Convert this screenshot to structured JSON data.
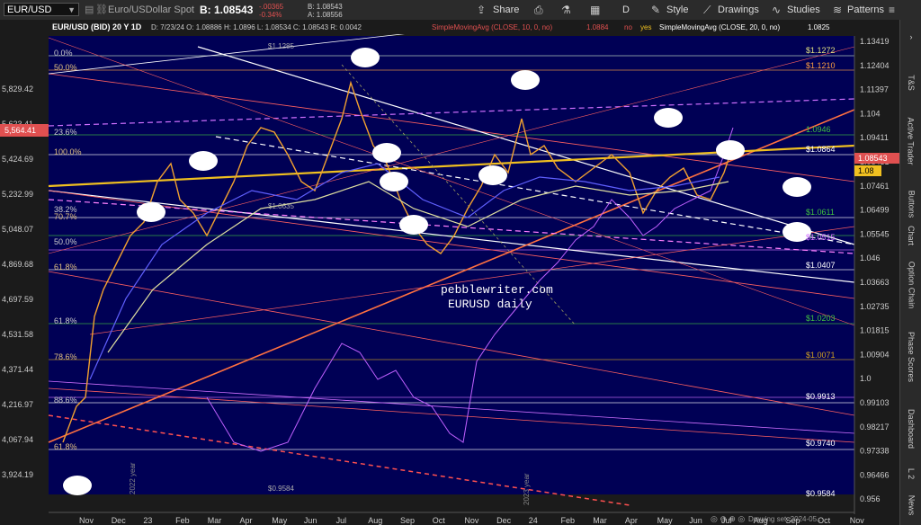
{
  "toolbar": {
    "symbol": "EUR/USD",
    "description": "Euro/USDollar Spot",
    "bid": "B: 1.08543",
    "change": "-.00365",
    "change_pct": "-0.34%",
    "bid_small": "B: 1.08543",
    "ask_small": "A: 1.08556",
    "share": "Share",
    "period": "D",
    "style": "Style",
    "drawings": "Drawings",
    "studies": "Studies",
    "patterns": "Patterns"
  },
  "header": {
    "title": "EUR/USD (BID) 20 Y 1D",
    "ohlc": "D: 7/23/24   O: 1.08886   H: 1.0896   L: 1.08534   C: 1.08543   R: 0.0042",
    "study1": "SimpleMovingAvg (CLOSE, 10, 0, no)",
    "study1_value": "1.0884",
    "no_label": "no",
    "yes_label": "yes",
    "study2": "SimpleMovingAvg (CLOSE, 20, 0, no)",
    "study2_value": "1.0825"
  },
  "watermark": {
    "line1": "pebblewriter.com",
    "line2": "EURUSD daily"
  },
  "left_axis": [
    "5,829.42",
    "5,623.41",
    "5,424.69",
    "5,232.99",
    "5,048.07",
    "4,869.68",
    "4,697.59",
    "4,531.58",
    "4,371.44",
    "4,216.97",
    "4,067.94",
    "3,924.19"
  ],
  "left_marker": "5,564.41",
  "right_axis": [
    "1.13419",
    "1.12404",
    "1.11397",
    "1.104",
    "1.09411",
    "1.08431",
    "1.07461",
    "1.06499",
    "1.05545",
    "1.046",
    "1.03663",
    "1.02735",
    "1.01815",
    "1.00904",
    "1.0",
    "0.99103",
    "0.98217",
    "0.97338",
    "0.96466",
    "0.956"
  ],
  "right_marker_price": "1.08543",
  "right_marker_level": "1.08",
  "x_labels": [
    "Nov",
    "Dec",
    "23",
    "Feb",
    "Mar",
    "Apr",
    "May",
    "Jun",
    "Jul",
    "Aug",
    "Sep",
    "Oct",
    "Nov",
    "Dec",
    "24",
    "Feb",
    "Mar",
    "Apr",
    "May",
    "Jun",
    "Jul",
    "Aug",
    "Sep",
    "Oct",
    "Nov"
  ],
  "fib_left": [
    "0.0%",
    "50.0%",
    "23.6%",
    "100.0%",
    "38.2%",
    "70.7%",
    "50.0%",
    "61.8%",
    "61.8%",
    "78.6%",
    "88.6%",
    "61.8%"
  ],
  "levels_right": [
    "$1.1272",
    "$1.1210",
    "1.0946",
    "$1.0864",
    "$1.0611",
    "$1.0515",
    "$1.0407",
    "$1.0203",
    "$1.0071",
    "$0.9913",
    "$0.9740",
    "$0.9584"
  ],
  "mid_labels": [
    "$1.1285",
    "$1.0635",
    "$0.9584"
  ],
  "year_labels": [
    "2022 year",
    "2023 year"
  ],
  "footer": "Drawing set: 2024-05..",
  "right_panel": [
    "T&S",
    "Active Trader",
    "Buttons",
    "Chart",
    "Option Chain",
    "Phase Scores",
    "Dashboard",
    "L 2",
    "News"
  ],
  "colors": {
    "chart_bg": "#000055",
    "toolbar_bg": "#2b2b2b",
    "accent_red": "#e05050",
    "price_marker": "#e05050",
    "level_marker": "#f0c020"
  }
}
